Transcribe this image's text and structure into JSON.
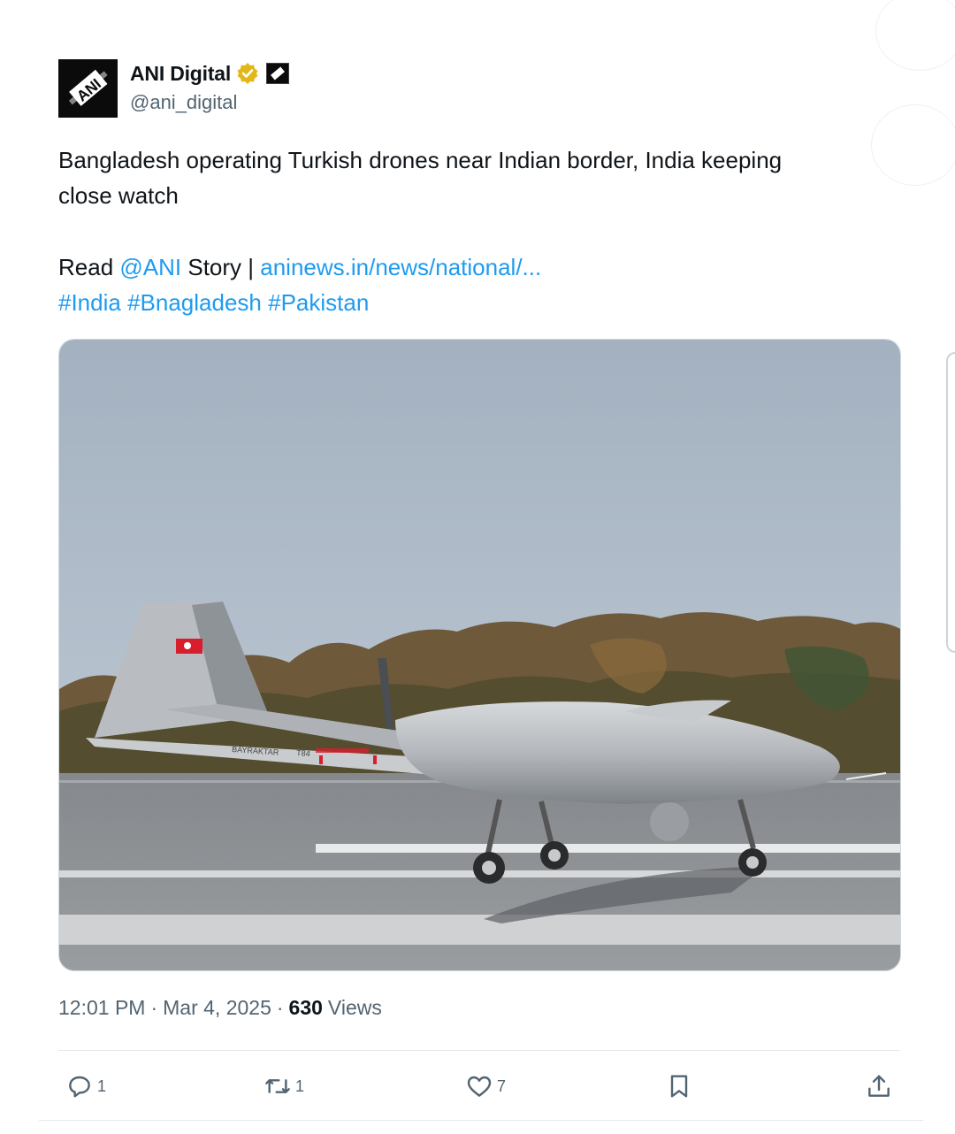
{
  "author": {
    "display_name": "ANI Digital",
    "handle": "@ani_digital",
    "avatar_text": "ANI",
    "verified_icon": "verified-badge-icon",
    "affiliate_icon": "affiliate-badge-icon"
  },
  "tweet": {
    "text_line1": "Bangladesh operating Turkish drones near Indian border, India keeping",
    "text_line2": "close watch",
    "read_prefix": "Read ",
    "mention": "@ANI",
    "story_text": " Story | ",
    "link_text": "aninews.in/news/national/...",
    "hashtags": [
      "#India",
      "#Bnagladesh",
      "#Pakistan"
    ]
  },
  "media": {
    "drone_label": "BAYRAKTAR",
    "drone_number": "T84"
  },
  "meta": {
    "time": "12:01 PM",
    "date": "Mar 4, 2025",
    "views_count": "630",
    "views_label": "Views",
    "separator": "·"
  },
  "actions": {
    "reply_count": "1",
    "retweet_count": "1",
    "like_count": "7",
    "icons": [
      "reply-icon",
      "retweet-icon",
      "like-icon",
      "bookmark-icon",
      "share-icon"
    ]
  },
  "colors": {
    "link": "#1d9bf0",
    "verified": "#e2b719",
    "secondary_text": "#536471"
  }
}
